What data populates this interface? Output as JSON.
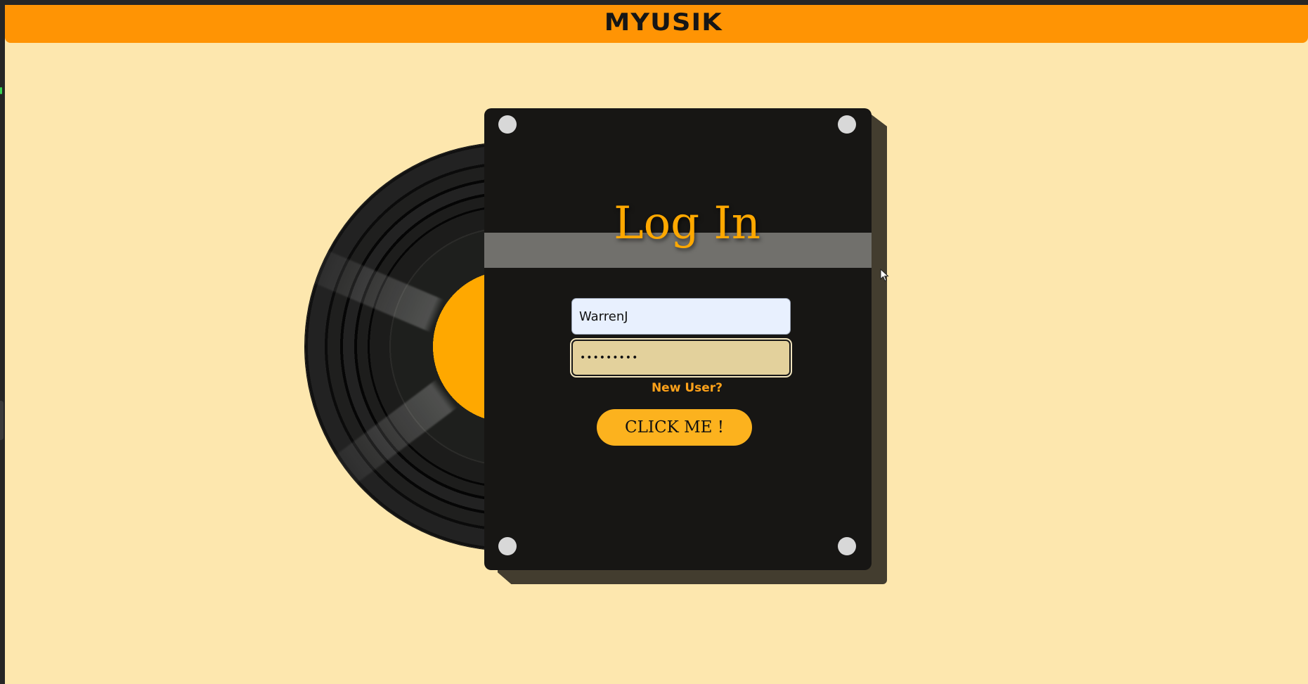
{
  "header": {
    "brand": "MYUSIK",
    "color": "#ff9404"
  },
  "page_background": "#fde7ae",
  "login": {
    "title": "Log In",
    "username_value": "WarrenJ",
    "password_value": "•••••••••",
    "new_user_link": "New User?",
    "submit_label": "CLICK ME !",
    "accent_color": "#ffa800"
  }
}
